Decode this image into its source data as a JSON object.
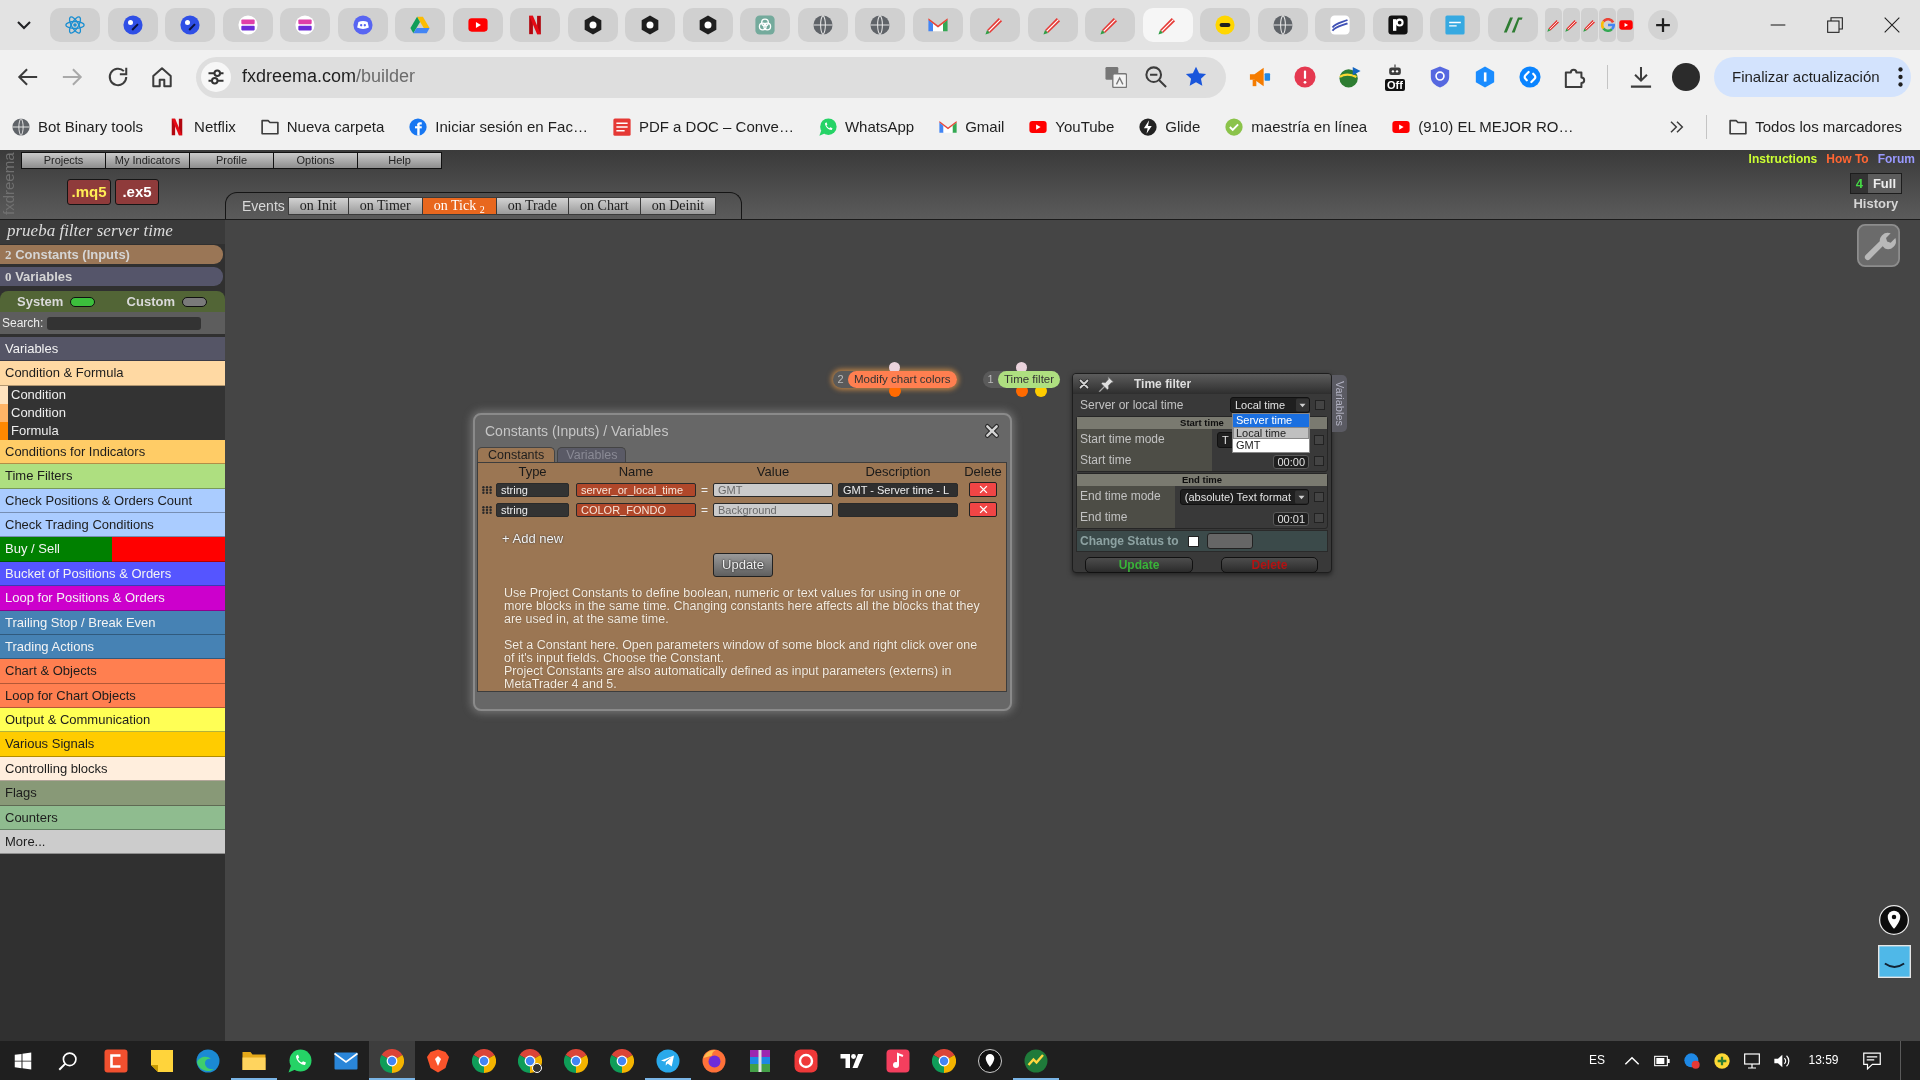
{
  "browser": {
    "tabs": [
      {
        "kind": "normal",
        "selected": false
      },
      {
        "kind": "normal",
        "selected": false
      },
      {
        "kind": "normal",
        "selected": false
      },
      {
        "kind": "normal",
        "selected": false
      },
      {
        "kind": "normal",
        "selected": false
      },
      {
        "kind": "normal",
        "selected": false
      },
      {
        "kind": "normal",
        "selected": false
      },
      {
        "kind": "normal",
        "selected": false
      },
      {
        "kind": "normal",
        "selected": false
      },
      {
        "kind": "normal",
        "selected": false
      },
      {
        "kind": "normal",
        "selected": false
      },
      {
        "kind": "normal",
        "selected": false
      },
      {
        "kind": "normal",
        "selected": false
      },
      {
        "kind": "normal",
        "selected": false
      },
      {
        "kind": "normal",
        "selected": false
      },
      {
        "kind": "normal",
        "selected": false
      },
      {
        "kind": "normal",
        "selected": false
      },
      {
        "kind": "normal",
        "selected": false
      },
      {
        "kind": "normal",
        "selected": false
      },
      {
        "kind": "normal",
        "selected": true
      },
      {
        "kind": "normal",
        "selected": false
      },
      {
        "kind": "normal",
        "selected": false
      },
      {
        "kind": "normal",
        "selected": false
      },
      {
        "kind": "normal",
        "selected": false
      },
      {
        "kind": "normal",
        "selected": false
      },
      {
        "kind": "normal",
        "selected": false
      },
      {
        "kind": "narrow",
        "selected": false
      },
      {
        "kind": "narrow",
        "selected": false
      },
      {
        "kind": "narrow",
        "selected": false
      },
      {
        "kind": "narrow",
        "selected": false
      },
      {
        "kind": "narrow",
        "selected": false
      }
    ],
    "address": {
      "host": "fxdreema.com",
      "path": "/builder"
    },
    "extension_badge": "Off",
    "update_button": "Finalizar actualización",
    "bookmarks": [
      "Bot Binary tools",
      "Netflix",
      "Nueva carpeta",
      "Iniciar sesión en Fac…",
      "PDF a DOC – Conve…",
      "WhatsApp",
      "Gmail",
      "YouTube",
      "Glide",
      "maestría en línea",
      "(910) EL MEJOR RO…"
    ],
    "all_bookmarks": "Todos los marcadores"
  },
  "app": {
    "brand": "fxdreema",
    "menu": [
      "Projects",
      "My Indicators",
      "Profile",
      "Options",
      "Help"
    ],
    "export_buttons": [
      {
        "label": ".mq5",
        "color": "#ffee55"
      },
      {
        "label": ".ex5",
        "color": "#ffffff"
      }
    ],
    "events": {
      "label": "Events",
      "tabs": [
        {
          "label": "on Init",
          "selected": false
        },
        {
          "label": "on Timer",
          "selected": false
        },
        {
          "label": "on Tick $_{2}$",
          "selected": true
        },
        {
          "label": "on Trade",
          "selected": false
        },
        {
          "label": "on Chart",
          "selected": false
        },
        {
          "label": "on Deinit",
          "selected": false
        }
      ]
    },
    "links": [
      {
        "label": "Instructions",
        "color": "#ccff33"
      },
      {
        "label": "How To",
        "color": "#ff6633"
      },
      {
        "label": "Forum",
        "color": "#9999ff"
      }
    ],
    "history": {
      "count": "4",
      "mode": "Full",
      "label": "History"
    },
    "project_title": "prueba filter server time",
    "sidebar": {
      "constants": {
        "count": "2",
        "label": "Constants (Inputs)"
      },
      "variables": {
        "count": "0",
        "label": "Variables"
      },
      "toggles": [
        {
          "label": "System",
          "on": true
        },
        {
          "label": "Custom",
          "on": false
        }
      ],
      "search_label": "Search:",
      "categories": [
        {
          "label": "Variables",
          "color": "#555566"
        },
        {
          "label": "Condition & Formula",
          "color": "#ffd9a3",
          "expanded": true,
          "children": [
            {
              "label": "Condition",
              "color": "#ffe3bf"
            },
            {
              "label": "Condition",
              "color": "#ffb466"
            },
            {
              "label": "Formula",
              "color": "#ff8800"
            }
          ]
        },
        {
          "label": "Conditions for Indicators",
          "color": "#ffcc66"
        },
        {
          "label": "Time Filters",
          "color": "#aedf80"
        },
        {
          "label": "Check Positions & Orders Count",
          "color": "#aaccff"
        },
        {
          "label": "Check Trading Conditions",
          "color": "#aaccff"
        },
        {
          "label": "Buy / Sell",
          "color": "#008000",
          "right_half": {
            "color": "#ff0000"
          }
        },
        {
          "label": "Bucket of Positions & Orders",
          "color": "#5555ff"
        },
        {
          "label": "Loop for Positions & Orders",
          "color": "#cc00cc"
        },
        {
          "label": "Trailing Stop / Break Even",
          "color": "#4682b4"
        },
        {
          "label": "Trading Actions",
          "color": "#4682b4"
        },
        {
          "label": "Chart & Objects",
          "color": "#ff7f50"
        },
        {
          "label": "Loop for Chart Objects",
          "color": "#ff7f50"
        },
        {
          "label": "Output & Communication",
          "color": "#ffff55"
        },
        {
          "label": "Various Signals",
          "color": "#ffcc00"
        },
        {
          "label": "Controlling blocks",
          "color": "#ffeedd"
        },
        {
          "label": "Flags",
          "color": "#889977"
        },
        {
          "label": "Counters",
          "color": "#8fbc8f"
        },
        {
          "label": "More...",
          "color": "#cccccc"
        }
      ]
    },
    "blocks": [
      {
        "number": "2",
        "label": "Modify chart colors",
        "color": "#ff7f50",
        "highlighted": true,
        "outputs": [
          {
            "color": "#ff6a00"
          }
        ]
      },
      {
        "number": "1",
        "label": "Time filter",
        "color": "#aedf80",
        "highlighted": false,
        "outputs": [
          {
            "color": "#ff6a00"
          },
          {
            "color": "#ffcc00"
          }
        ]
      }
    ],
    "constants_dialog": {
      "title": "Constants (Inputs) / Variables",
      "tabs": [
        {
          "label": "Constants",
          "selected": true
        },
        {
          "label": "Variables",
          "selected": false
        }
      ],
      "columns": [
        "Type",
        "Name",
        "Value",
        "Description",
        "Delete"
      ],
      "rows": [
        {
          "type": "string",
          "name": "server_or_local_time",
          "operator": "=",
          "value": "GMT",
          "description": "GMT - Server time - L"
        },
        {
          "type": "string",
          "name": "COLOR_FONDO",
          "operator": "=",
          "value": "Background"
        }
      ],
      "add_new": "+ Add new",
      "update_button": "Update",
      "help": [
        "Use Project Constants to define boolean, numeric or text values for using in one or more blocks in the same time. Changing constants here affects all the blocks that they are used in, at the same time.",
        "Set a Constant here. Open parameters window of some block and right click over one of it's input fields. Choose the Constant.\nProject Constants are also automatically defined as input parameters (externs) in MetaTrader 4 and 5."
      ]
    },
    "parameters_window": {
      "title": "Time filter",
      "side_tab": "Variables",
      "params": [
        {
          "label": "Server or local time",
          "kind": "select",
          "value": "Local time",
          "checked": false,
          "open": true,
          "options": [
            {
              "label": "Server time",
              "highlighted": true,
              "selected": false
            },
            {
              "label": "Local time",
              "highlighted": false,
              "selected": true
            },
            {
              "label": "GMT",
              "highlighted": false,
              "selected": false
            }
          ]
        }
      ],
      "groups": [
        {
          "title": "Start time",
          "params": [
            {
              "label": "Start time mode",
              "kind": "select",
              "value": "T",
              "checked": false
            },
            {
              "label": "Start time",
              "kind": "time",
              "value": "00:00",
              "checked": false
            }
          ]
        },
        {
          "title": "End time",
          "params": [
            {
              "label": "End time mode",
              "kind": "select",
              "value": "(absolute) Text format",
              "checked": false
            },
            {
              "label": "End time",
              "kind": "time",
              "value": "00:01",
              "checked": false
            }
          ]
        }
      ],
      "status": {
        "label": "Change Status to",
        "checked": false
      },
      "buttons": [
        {
          "label": "Update",
          "kind": "update"
        },
        {
          "label": "Delete",
          "kind": "delete"
        }
      ]
    }
  },
  "taskbar": {
    "apps": [
      {
        "running": false,
        "active": false
      },
      {
        "running": false,
        "active": false
      },
      {
        "running": false,
        "active": false
      },
      {
        "running": true,
        "active": false
      },
      {
        "running": false,
        "active": false
      },
      {
        "running": false,
        "active": false
      },
      {
        "running": true,
        "active": true
      },
      {
        "running": false,
        "active": false
      },
      {
        "running": false,
        "active": false
      },
      {
        "running": false,
        "active": false
      },
      {
        "running": false,
        "active": false
      },
      {
        "running": false,
        "active": false
      },
      {
        "running": true,
        "active": false
      },
      {
        "running": false,
        "active": false
      },
      {
        "running": false,
        "active": false
      },
      {
        "running": false,
        "active": false
      },
      {
        "running": false,
        "active": false
      },
      {
        "running": false,
        "active": false
      },
      {
        "running": false,
        "active": false
      },
      {
        "running": false,
        "active": false
      },
      {
        "running": true,
        "active": false
      }
    ],
    "language": "ES",
    "time": "13:59"
  }
}
